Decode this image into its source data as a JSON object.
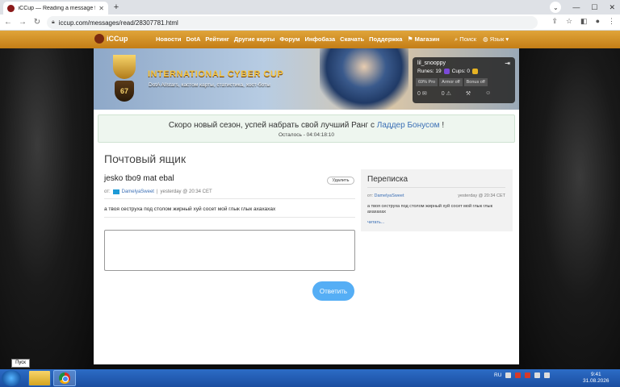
{
  "browser": {
    "tab_title": "iCCup — Reading a message fro",
    "tab_close": "✕",
    "new_tab": "+",
    "chevron": "⌄",
    "minimize": "—",
    "maximize": "☐",
    "close": "✕",
    "back": "←",
    "forward": "→",
    "reload": "↻",
    "url": "iccup.com/messages/read/28307781.html",
    "share": "⇪",
    "star": "☆",
    "panel": "◧",
    "profile": "●",
    "kebab": "⋮"
  },
  "site_nav": {
    "logo_text": "iCCup",
    "items": [
      "Новости",
      "DotA",
      "Рейтинг",
      "Другие карты",
      "Форум",
      "Инфобаза",
      "Скачать",
      "Поддержка",
      "Магазин"
    ],
    "search_label": "Поиск",
    "language_label": "Язык"
  },
  "banner": {
    "level": "67",
    "title": "INTERNATIONAL CYBER CUP",
    "subtitle": "DotA Allstars, кастом карты, статистика, хост-боты"
  },
  "user_panel": {
    "username": "lil_snooppy",
    "runes_label": "Runes: 19",
    "cups_label": "Cups: 0",
    "pro_label": "69% Pro",
    "armor_label": "Armor off",
    "bonus_label": "Bonus off",
    "mail_count": "0",
    "alert_count": "0"
  },
  "notice": {
    "text_before": "Скоро новый сезон, успей набрать свой лучший Ранг с",
    "link_text": "Ладдер Бонусом",
    "text_after": "!",
    "countdown": "Осталось - 04:04:18:10"
  },
  "mailbox": {
    "heading": "Почтовый ящик",
    "message_title": "jesko tbo9 mat ebal",
    "delete_label": "Удалить",
    "from_label": "от:",
    "author": "DamelyaSweet",
    "date": "yesterday @ 20:34 CET",
    "body": "а твоя сеструха под столом жирный хуй сосет мой глык глык ахахахах",
    "reply_value": "",
    "send_label": "Ответить"
  },
  "sidebar": {
    "title": "Переписка",
    "from_label": "от:",
    "author": "DamelyaSweet",
    "date": "yesterday @ 20:34 CET",
    "body": "а твоя сеструха под столом жирный хуй сосет мой глык глык ахахахах",
    "more_label": "читать..."
  },
  "taskbar": {
    "tooltip": "Пуск",
    "lang": "RU",
    "time": "9:41",
    "date": "31.08.2026"
  }
}
